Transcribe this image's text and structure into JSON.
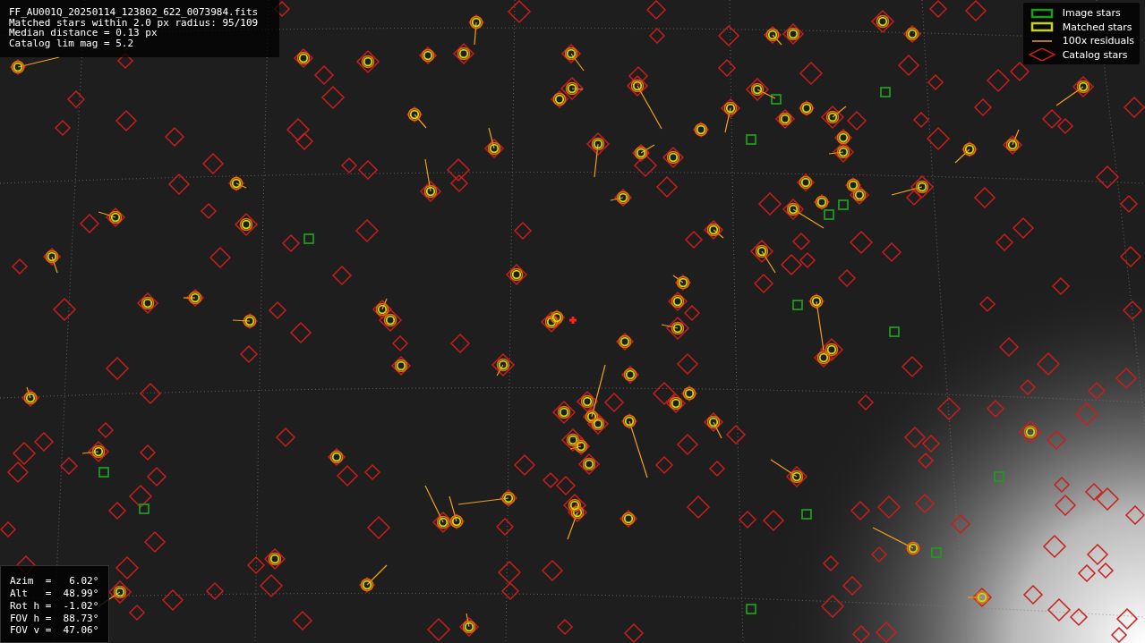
{
  "info_lines": [
    "FF_AU001Q_20250114_123802_622_0073984.fits",
    "Matched stars within 2.0 px radius: 95/109",
    "Median distance = 0.13 px",
    "Catalog lim mag = 5.2"
  ],
  "legend": [
    {
      "kind": "image",
      "label": "Image stars"
    },
    {
      "kind": "matched",
      "label": "Matched stars"
    },
    {
      "kind": "residual",
      "label": "100x residuals"
    },
    {
      "kind": "catalog",
      "label": "Catalog stars"
    }
  ],
  "pointing": [
    "Azim  =   6.02°",
    "Alt   =  48.99°",
    "Rot h =  -1.02°",
    "FOV h =  88.73°",
    "FOV v =  47.06°"
  ]
}
